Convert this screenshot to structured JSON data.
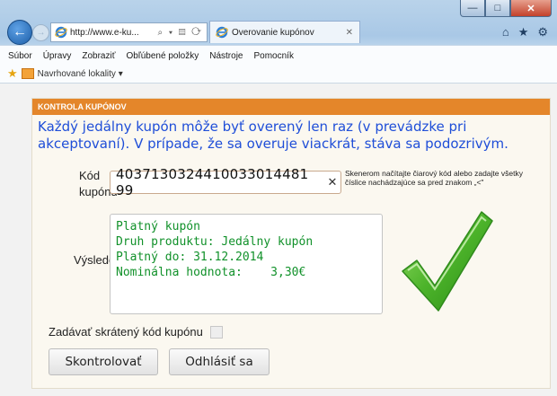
{
  "browser": {
    "window_controls": {
      "minimize": "—",
      "maximize": "□",
      "close": "✕"
    },
    "address": "http://www.e-ku...",
    "address_tools": "⌕ ▾ ▤ ⟳",
    "tab": {
      "title": "Overovanie kupónov",
      "close": "✕"
    },
    "right_icons": {
      "home": "⌂",
      "favorites": "★",
      "settings": "⚙"
    },
    "menu": [
      "Súbor",
      "Úpravy",
      "Zobraziť",
      "Obľúbené položky",
      "Nástroje",
      "Pomocník"
    ],
    "favorites_bar": {
      "suggested": "Navrhované lokality ▾"
    }
  },
  "page": {
    "header": "KONTROLA KUPÓNOV",
    "notice": "Každý jedálny kupón môže byť overený len raz (v prevádzke pri akceptovaní). V prípade, že sa overuje viackrát, stáva sa podozrivým.",
    "code_label": "Kód kupónu",
    "code_value": "4037130324410033014481​99",
    "scan_hint": "Skenerom načítajte čiarový kód alebo zadajte všetky číslice nachádzajúce sa pred znakom „<\"",
    "result_label": "Výsledok",
    "result_lines": [
      "Platný kupón",
      "Druh produktu: Jedálny kupón",
      "Platný do: 31.12.2014",
      "Nominálna hodnota:    3,30€"
    ],
    "short_code_label": "Zadávať skrátený kód kupónu",
    "buttons": {
      "check": "Skontrolovať",
      "logout": "Odhlásiť sa"
    },
    "colors": {
      "header": "#e4862a",
      "notice": "#1f4ed8",
      "result_text": "#11912a",
      "check_icon": "#4cb32a"
    }
  }
}
